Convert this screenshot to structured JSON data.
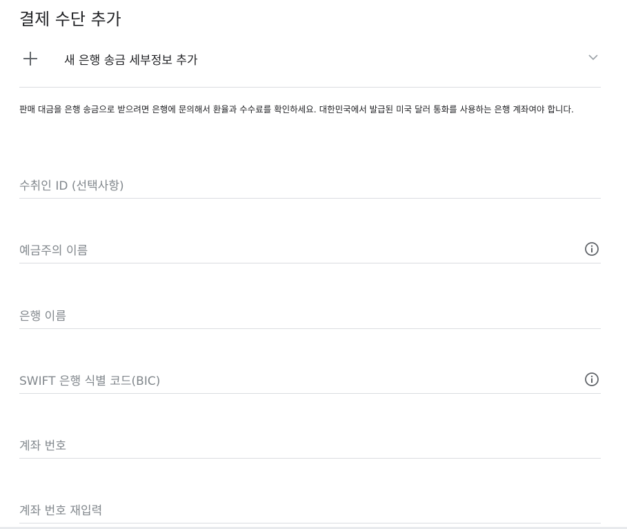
{
  "page": {
    "title": "결제 수단 추가"
  },
  "add_bank": {
    "icon": "plus-icon",
    "label": "새 은행 송금 세부정보 추가",
    "chevron_icon": "chevron-down-icon"
  },
  "notice": {
    "text": "판매 대금을 은행 송금으로 받으려면 은행에 문의해서 환율과 수수료를 확인하세요. 대한민국에서 발급된 미국 달러 통화를 사용하는 은행 계좌여야 합니다."
  },
  "fields": [
    {
      "label": "수취인 ID (선택사항)",
      "info": false
    },
    {
      "label": "예금주의 이름",
      "info": true
    },
    {
      "label": "은행 이름",
      "info": false
    },
    {
      "label": "SWIFT 은행 식별 코드(BIC)",
      "info": true
    },
    {
      "label": "계좌 번호",
      "info": false
    },
    {
      "label": "계좌 번호 재입력",
      "info": false
    }
  ],
  "colors": {
    "text": "#202124",
    "placeholder": "#80868b",
    "divider": "#dadce0",
    "icon": "#5f6368"
  }
}
